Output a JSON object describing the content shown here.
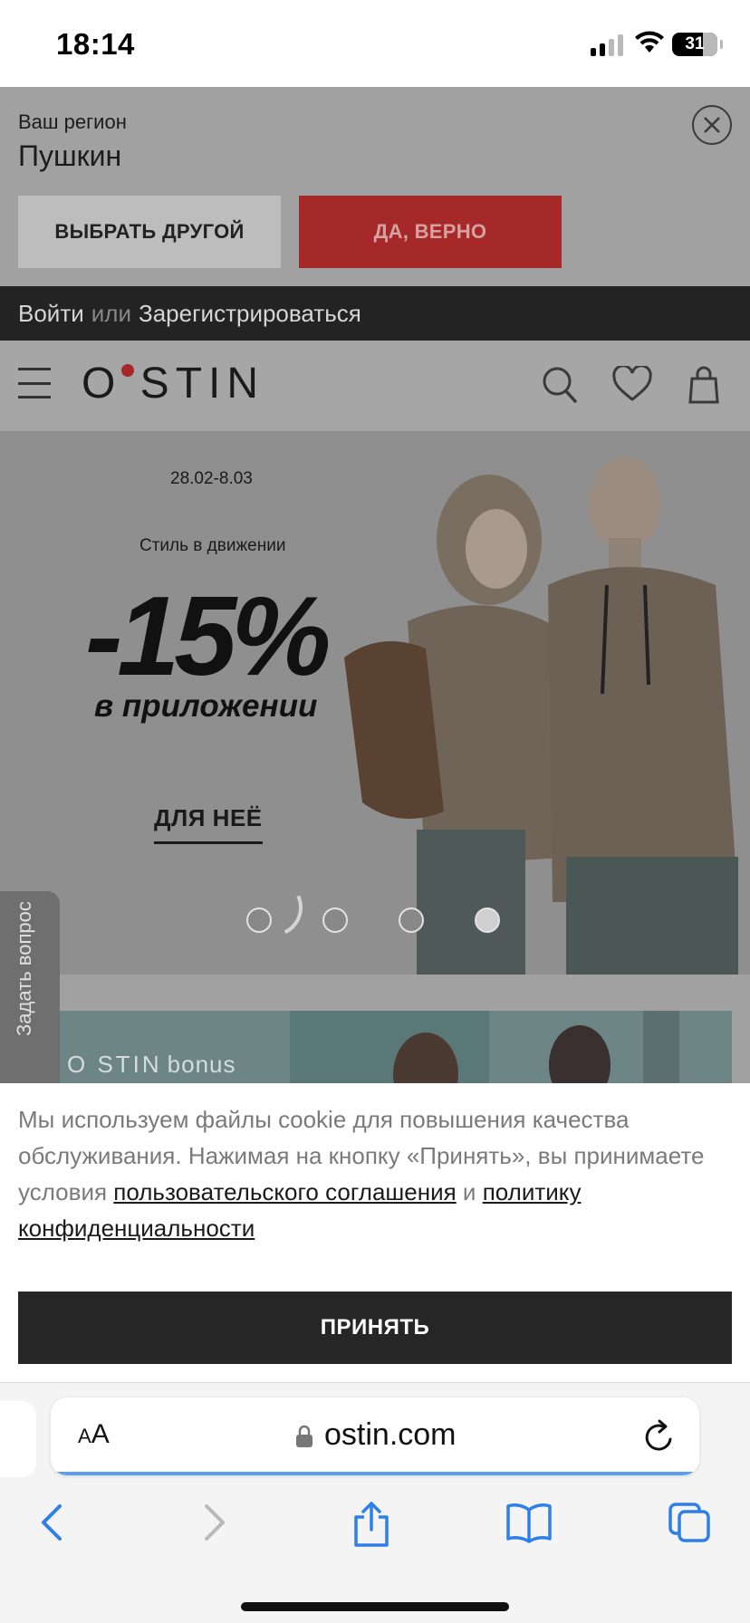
{
  "status_bar": {
    "time": "18:14",
    "battery": "31"
  },
  "region_popup": {
    "label": "Ваш регион",
    "city": "Пушкин",
    "choose_other": "ВЫБРАТЬ ДРУГОЙ",
    "confirm": "ДА, ВЕРНО"
  },
  "auth_bar": {
    "login": "Войти",
    "or": "или",
    "register": "Зарегистрироваться"
  },
  "header": {
    "logo": "O STIN"
  },
  "hero": {
    "date": "28.02-8.03",
    "tagline": "Стиль в движении",
    "discount": "-15%",
    "discount_note": "в приложении",
    "cta": "ДЛЯ НЕЁ",
    "slides_total": 4,
    "active_slide": 4
  },
  "ask_question": "Задать вопрос",
  "bonus_banner": {
    "brand": "O STIN",
    "label": "bonus"
  },
  "cookie": {
    "text_before": "Мы используем файлы cookie для повышения качества обслуживания. Нажимая на кнопку «Принять», вы принимаете условия ",
    "agreement_link": "пользовательского соглашения",
    "text_middle": " и ",
    "privacy_link": "политику конфиденциальности",
    "accept": "ПРИНЯТЬ"
  },
  "safari": {
    "text_size_small": "A",
    "text_size_large": "A",
    "url": "ostin.com"
  },
  "colors": {
    "brand_red": "#a6292a",
    "dark": "#262626",
    "progress_blue": "#5aa0ef"
  }
}
